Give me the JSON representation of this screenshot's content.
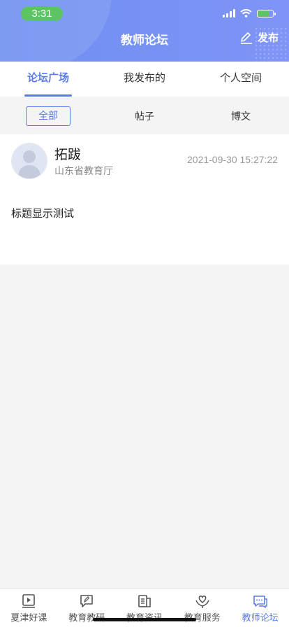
{
  "status": {
    "time": "3:31"
  },
  "header": {
    "title": "教师论坛",
    "publish_label": "发布"
  },
  "tabs": [
    {
      "label": "论坛广场",
      "active": true
    },
    {
      "label": "我发布的",
      "active": false
    },
    {
      "label": "个人空间",
      "active": false
    }
  ],
  "filters": [
    {
      "label": "全部",
      "active": true
    },
    {
      "label": "帖子",
      "active": false
    },
    {
      "label": "博文",
      "active": false
    }
  ],
  "post": {
    "author": "拓跋",
    "org": "山东省教育厅",
    "time": "2021-09-30 15:27:22",
    "title": "标题显示测试"
  },
  "bottom_nav": [
    {
      "label": "夏津好课",
      "icon": "play-video-icon",
      "active": false
    },
    {
      "label": "教育教研",
      "icon": "edit-chat-icon",
      "active": false
    },
    {
      "label": "教育资讯",
      "icon": "news-icon",
      "active": false
    },
    {
      "label": "教育服务",
      "icon": "heart-hands-icon",
      "active": false
    },
    {
      "label": "教师论坛",
      "icon": "forum-chat-icon",
      "active": true
    }
  ],
  "colors": {
    "accent": "#5b7ce8",
    "header": "#7390f2",
    "status_pill": "#5cc463"
  }
}
